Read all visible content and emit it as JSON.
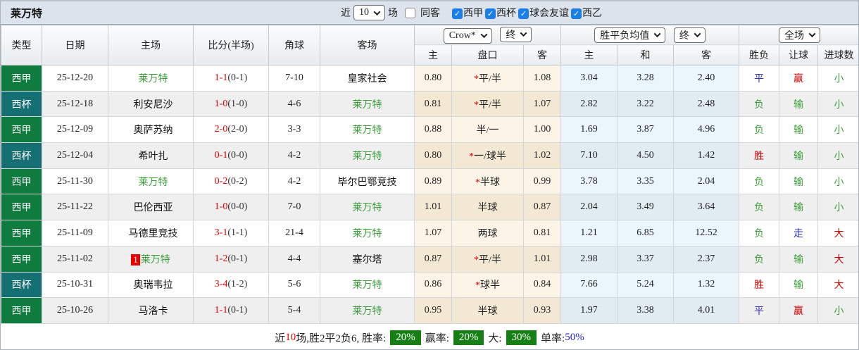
{
  "topbar": {
    "title": "莱万特",
    "recent_label": "近",
    "recent_value": "10",
    "recent_suffix": "场",
    "same_away_label": "同客",
    "filters": [
      {
        "label": "西甲",
        "checked": true
      },
      {
        "label": "西杯",
        "checked": true
      },
      {
        "label": "球会友谊",
        "checked": true
      },
      {
        "label": "西乙",
        "checked": true
      }
    ]
  },
  "header": {
    "type": "类型",
    "date": "日期",
    "home": "主场",
    "score": "比分(半场)",
    "corner": "角球",
    "away": "客场",
    "odds_source": "Crow*",
    "odds_state": "终",
    "avg_source": "胜平负均值",
    "avg_state": "终",
    "full_match": "全场",
    "sub_home": "主",
    "sub_handicap": "盘口",
    "sub_away": "客",
    "sub_win": "主",
    "sub_draw": "和",
    "sub_lose": "客",
    "sub_wdl": "胜负",
    "sub_let": "让球",
    "sub_goals": "进球数"
  },
  "rows": [
    {
      "league": "西甲",
      "league_type": "liga",
      "date": "25-12-20",
      "home": "莱万特",
      "home_green": true,
      "home_badge": "",
      "score": "1-1",
      "half": "(0-1)",
      "corner": "7-10",
      "away": "皇家社会",
      "away_green": false,
      "odds_home": "0.80",
      "handicap": "*平/半",
      "odds_away": "1.08",
      "avg_win": "3.04",
      "avg_draw": "3.28",
      "avg_lose": "2.40",
      "wdl": "平",
      "let": "赢",
      "goals": "小"
    },
    {
      "league": "西杯",
      "league_type": "copa",
      "date": "25-12-18",
      "home": "利安尼沙",
      "home_green": false,
      "home_badge": "",
      "score": "1-0",
      "half": "(1-0)",
      "corner": "4-6",
      "away": "莱万特",
      "away_green": true,
      "odds_home": "0.81",
      "handicap": "*平/半",
      "odds_away": "1.07",
      "avg_win": "2.82",
      "avg_draw": "3.22",
      "avg_lose": "2.48",
      "wdl": "负",
      "let": "输",
      "goals": "小"
    },
    {
      "league": "西甲",
      "league_type": "liga",
      "date": "25-12-09",
      "home": "奥萨苏纳",
      "home_green": false,
      "home_badge": "",
      "score": "2-0",
      "half": "(2-0)",
      "corner": "3-3",
      "away": "莱万特",
      "away_green": true,
      "odds_home": "0.88",
      "handicap": "半/一",
      "odds_away": "1.00",
      "avg_win": "1.69",
      "avg_draw": "3.87",
      "avg_lose": "4.96",
      "wdl": "负",
      "let": "输",
      "goals": "小"
    },
    {
      "league": "西杯",
      "league_type": "copa",
      "date": "25-12-04",
      "home": "希叶扎",
      "home_green": false,
      "home_badge": "",
      "score": "0-1",
      "half": "(0-0)",
      "corner": "4-2",
      "away": "莱万特",
      "away_green": true,
      "odds_home": "0.80",
      "handicap": "*一/球半",
      "odds_away": "1.02",
      "avg_win": "7.10",
      "avg_draw": "4.50",
      "avg_lose": "1.42",
      "wdl": "胜",
      "let": "输",
      "goals": "小"
    },
    {
      "league": "西甲",
      "league_type": "liga",
      "date": "25-11-30",
      "home": "莱万特",
      "home_green": true,
      "home_badge": "",
      "score": "0-2",
      "half": "(0-2)",
      "corner": "4-2",
      "away": "毕尔巴鄂竞技",
      "away_green": false,
      "odds_home": "0.89",
      "handicap": "*半球",
      "odds_away": "0.99",
      "avg_win": "3.78",
      "avg_draw": "3.35",
      "avg_lose": "2.04",
      "wdl": "负",
      "let": "输",
      "goals": "小"
    },
    {
      "league": "西甲",
      "league_type": "liga",
      "date": "25-11-22",
      "home": "巴伦西亚",
      "home_green": false,
      "home_badge": "",
      "score": "1-0",
      "half": "(0-0)",
      "corner": "7-0",
      "away": "莱万特",
      "away_green": true,
      "odds_home": "1.01",
      "handicap": "半球",
      "odds_away": "0.87",
      "avg_win": "2.04",
      "avg_draw": "3.49",
      "avg_lose": "3.64",
      "wdl": "负",
      "let": "输",
      "goals": "小"
    },
    {
      "league": "西甲",
      "league_type": "liga",
      "date": "25-11-09",
      "home": "马德里竞技",
      "home_green": false,
      "home_badge": "",
      "score": "3-1",
      "half": "(1-1)",
      "corner": "21-4",
      "away": "莱万特",
      "away_green": true,
      "odds_home": "1.07",
      "handicap": "两球",
      "odds_away": "0.81",
      "avg_win": "1.21",
      "avg_draw": "6.85",
      "avg_lose": "12.52",
      "wdl": "负",
      "let": "走",
      "goals": "大"
    },
    {
      "league": "西甲",
      "league_type": "liga",
      "date": "25-11-02",
      "home": "莱万特",
      "home_green": true,
      "home_badge": "1",
      "score": "1-2",
      "half": "(0-1)",
      "corner": "4-4",
      "away": "塞尔塔",
      "away_green": false,
      "odds_home": "0.87",
      "handicap": "*平/半",
      "odds_away": "1.01",
      "avg_win": "2.98",
      "avg_draw": "3.37",
      "avg_lose": "2.37",
      "wdl": "负",
      "let": "输",
      "goals": "大"
    },
    {
      "league": "西杯",
      "league_type": "copa",
      "date": "25-10-31",
      "home": "奥瑞韦拉",
      "home_green": false,
      "home_badge": "",
      "score": "3-4",
      "half": "(1-2)",
      "corner": "5-6",
      "away": "莱万特",
      "away_green": true,
      "odds_home": "0.86",
      "handicap": "*球半",
      "odds_away": "0.84",
      "avg_win": "7.66",
      "avg_draw": "5.24",
      "avg_lose": "1.32",
      "wdl": "胜",
      "let": "输",
      "goals": "大"
    },
    {
      "league": "西甲",
      "league_type": "liga",
      "date": "25-10-26",
      "home": "马洛卡",
      "home_green": false,
      "home_badge": "",
      "score": "1-1",
      "half": "(0-1)",
      "corner": "5-4",
      "away": "莱万特",
      "away_green": true,
      "odds_home": "0.95",
      "handicap": "半球",
      "odds_away": "0.93",
      "avg_win": "1.97",
      "avg_draw": "3.38",
      "avg_lose": "4.01",
      "wdl": "平",
      "let": "赢",
      "goals": "小"
    }
  ],
  "summary": {
    "near_label": "近",
    "near_count": "10",
    "stats_text": "场,胜2平2负6, 胜率:",
    "win_rate": "20%",
    "yield_label": "赢率:",
    "yield_rate": "20%",
    "big_label": "大:",
    "big_rate": "30%",
    "single_label": "单率:",
    "single_rate": "50%"
  },
  "colors": {
    "liga_badge": "#0e7c3f",
    "copa_badge": "#166f73",
    "team_highlight": "#3a9d3a",
    "score_red": "#e60000",
    "result_win_red": "#d10000",
    "result_draw_blue": "#3333bb",
    "result_lose_green": "#3a9d3a",
    "summary_badge_green": "#168016",
    "checkbox_blue": "#1a7fe8",
    "topbar_bg": "#dce3ec"
  }
}
